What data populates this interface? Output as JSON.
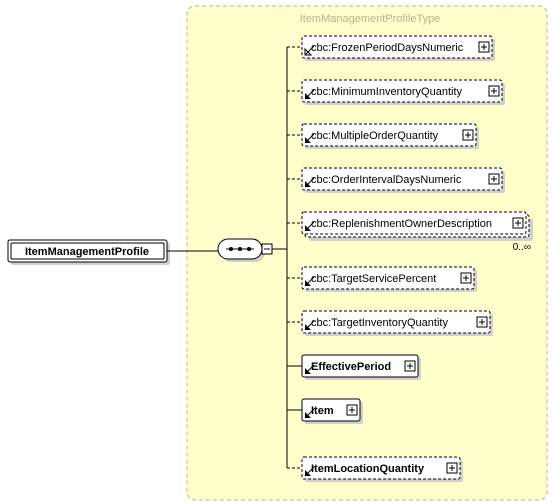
{
  "diagram": {
    "type_label": "ItemManagementProfileType",
    "root": "ItemManagementProfile",
    "cardinality": "0..∞",
    "children": [
      {
        "label": "cbc:FrozenPeriodDaysNumeric",
        "optional": true,
        "nav": true,
        "bold": false
      },
      {
        "label": "cbc:MinimumInventoryQuantity",
        "optional": true,
        "nav": true,
        "bold": false
      },
      {
        "label": "cbc:MultipleOrderQuantity",
        "optional": true,
        "nav": true,
        "bold": false
      },
      {
        "label": "cbc:OrderIntervalDaysNumeric",
        "optional": true,
        "nav": true,
        "bold": false
      },
      {
        "label": "cbc:ReplenishmentOwnerDescription",
        "optional": true,
        "nav": true,
        "bold": false,
        "cardinality": "0..∞"
      },
      {
        "label": "cbc:TargetServicePercent",
        "optional": true,
        "nav": true,
        "bold": false
      },
      {
        "label": "cbc:TargetInventoryQuantity",
        "optional": true,
        "nav": true,
        "bold": false
      },
      {
        "label": "EffectivePeriod",
        "optional": false,
        "nav": true,
        "bold": true
      },
      {
        "label": "Item",
        "optional": false,
        "nav": true,
        "bold": true
      },
      {
        "label": "ItemLocationQuantity",
        "optional": true,
        "nav": true,
        "bold": true
      }
    ]
  }
}
